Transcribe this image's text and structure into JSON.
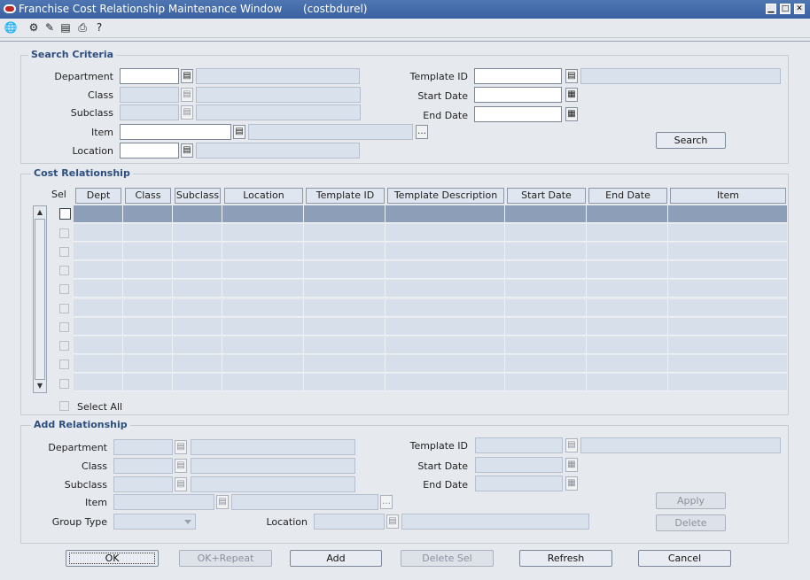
{
  "window": {
    "title": "Franchise Cost Relationship Maintenance Window",
    "module": "(costbdurel)",
    "minimize": "▁",
    "maximize": "□",
    "close": "✕"
  },
  "toolbar": {
    "icons": [
      "globe-icon",
      "action-icon",
      "edit-icon",
      "list-icon",
      "print-icon",
      "help-icon"
    ]
  },
  "search_criteria": {
    "title": "Search Criteria",
    "department_label": "Department",
    "class_label": "Class",
    "subclass_label": "Subclass",
    "item_label": "Item",
    "location_label": "Location",
    "template_id_label": "Template ID",
    "start_date_label": "Start Date",
    "end_date_label": "End Date",
    "search_button": "Search"
  },
  "cost_relationship": {
    "title": "Cost Relationship",
    "sel_label": "Sel",
    "columns": [
      "Dept",
      "Class",
      "Subclass",
      "Location",
      "Template ID",
      "Template Description",
      "Start Date",
      "End Date",
      "Item"
    ],
    "select_all_label": "Select All"
  },
  "add_relationship": {
    "title": "Add Relationship",
    "department_label": "Department",
    "class_label": "Class",
    "subclass_label": "Subclass",
    "item_label": "Item",
    "group_type_label": "Group Type",
    "location_label": "Location",
    "template_id_label": "Template ID",
    "start_date_label": "Start Date",
    "end_date_label": "End Date",
    "apply_button": "Apply",
    "delete_button": "Delete"
  },
  "footer": {
    "ok": "OK",
    "ok_repeat": "OK+Repeat",
    "add": "Add",
    "delete_sel": "Delete Sel",
    "refresh": "Refresh",
    "cancel": "Cancel"
  }
}
